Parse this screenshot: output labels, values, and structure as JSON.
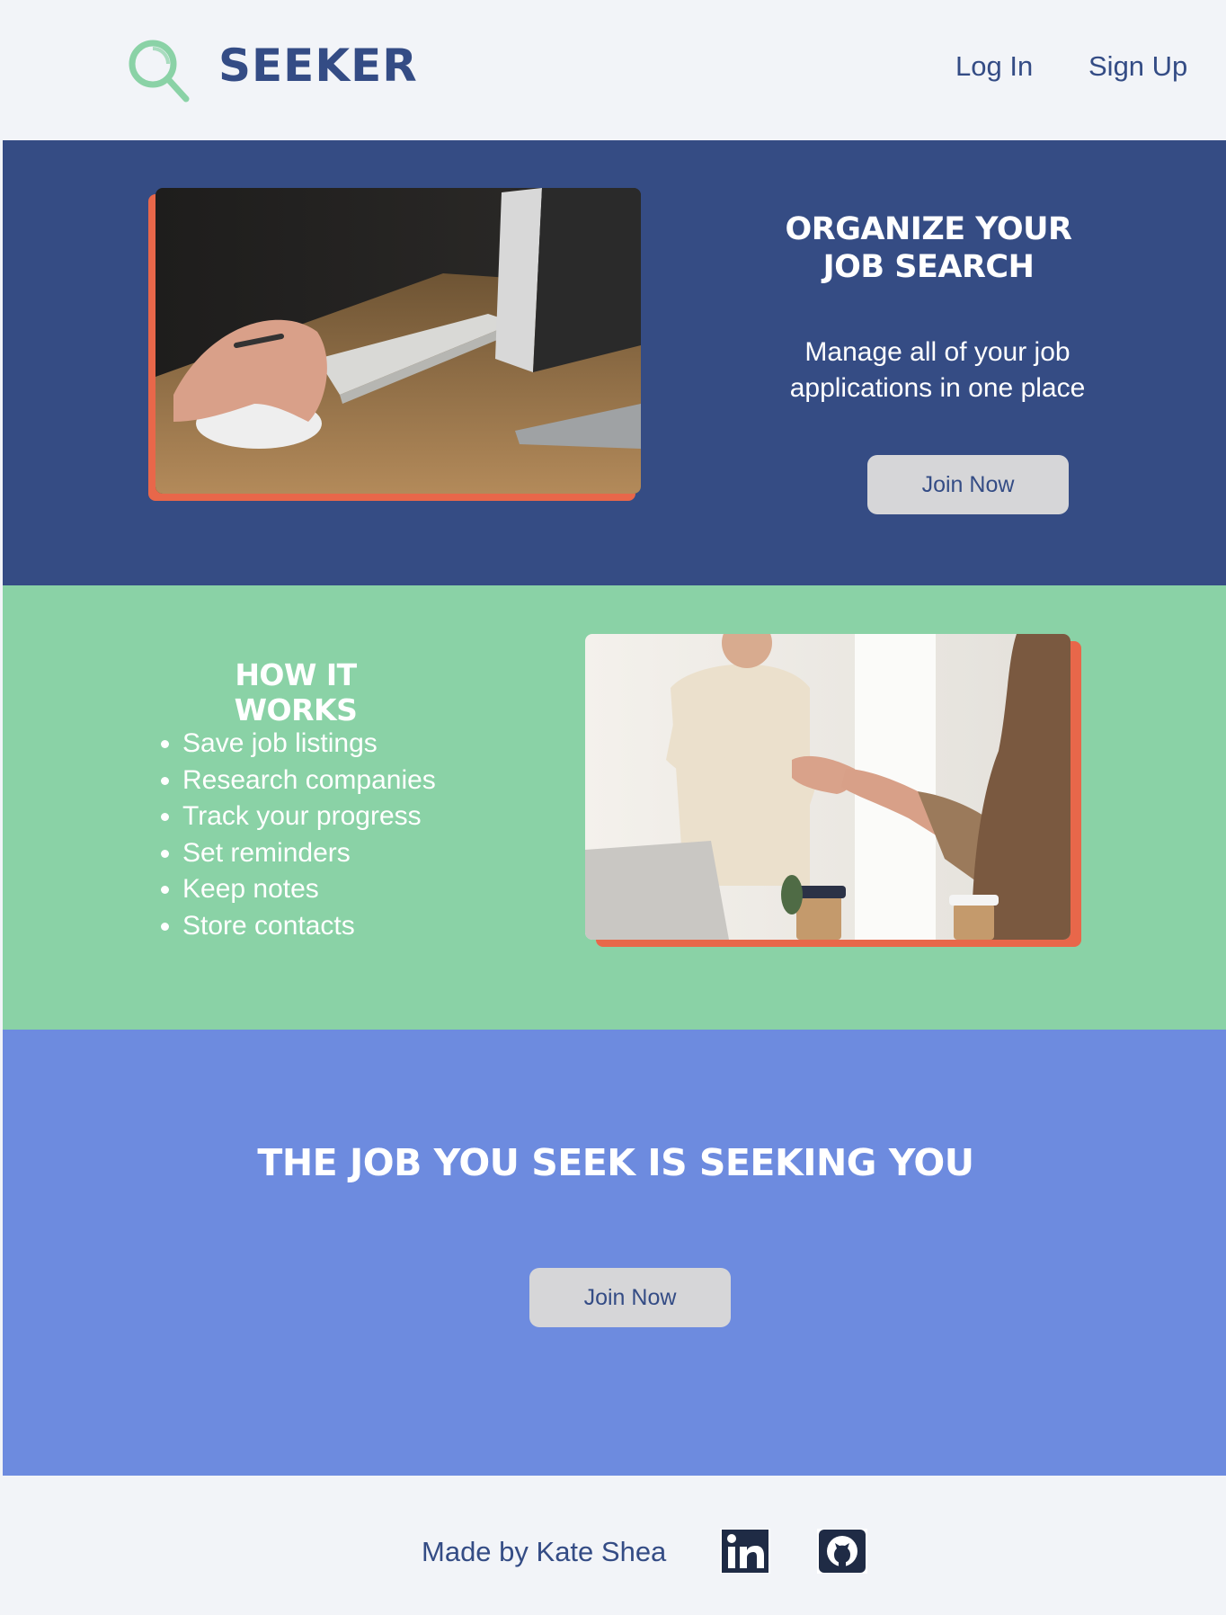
{
  "header": {
    "logo_text": "SEEKER",
    "nav": {
      "login": "Log In",
      "signup": "Sign Up"
    }
  },
  "hero": {
    "title_line1": "ORGANIZE YOUR",
    "title_line2": "JOB SEARCH",
    "subtitle_line1": "Manage all of your job",
    "subtitle_line2": "applications in one place",
    "button": "Join Now"
  },
  "how": {
    "title": "HOW IT WORKS",
    "items": [
      "Save job listings",
      "Research companies",
      "Track your progress",
      "Set reminders",
      "Keep notes",
      "Store contacts"
    ]
  },
  "tagline": {
    "title": "THE JOB YOU SEEK IS SEEKING YOU",
    "button": "Join Now"
  },
  "footer": {
    "credit": "Made by Kate Shea",
    "social": [
      "linkedin-icon",
      "github-icon"
    ]
  },
  "colors": {
    "navy": "#354c84",
    "green": "#8ad2a6",
    "periwinkle": "#6d8bdf",
    "accent": "#e8674a",
    "button": "#d6d6d8",
    "background": "#f2f4f8"
  }
}
